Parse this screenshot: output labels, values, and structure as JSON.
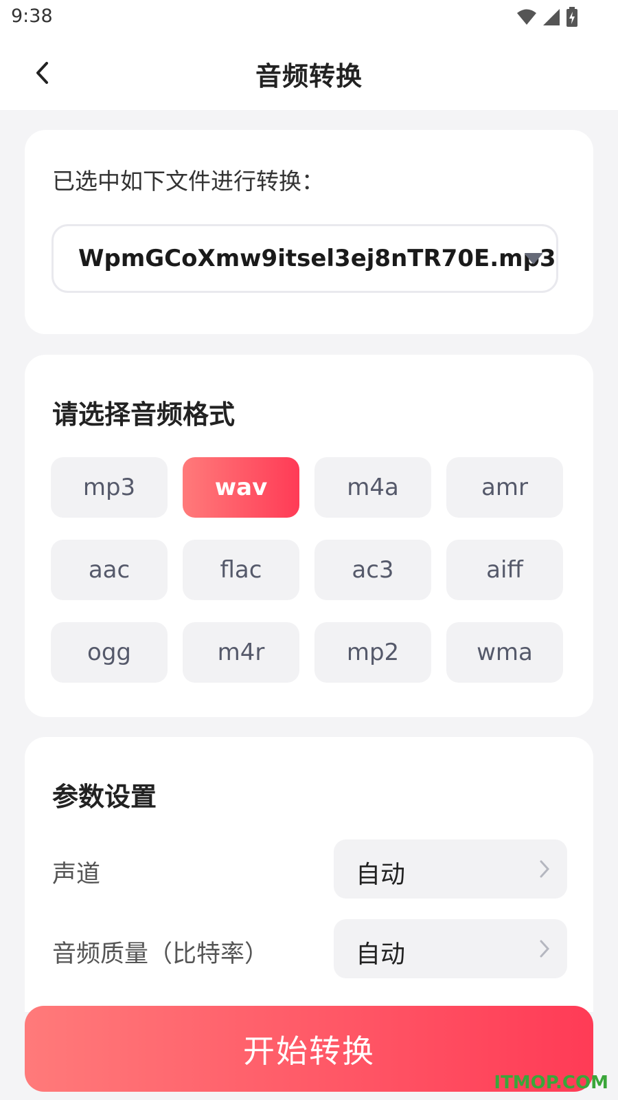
{
  "status_bar": {
    "time": "9:38",
    "icons": [
      "wifi-icon",
      "signal-icon",
      "battery-charging-icon"
    ]
  },
  "header": {
    "title": "音频转换",
    "back_icon": "chevron-left-icon"
  },
  "file_card": {
    "label": "已选中如下文件进行转换：",
    "selected_file": "WpmGCoXmw9itsel3ej8nTR70E.mp3",
    "dropdown_icon": "caret-down-icon"
  },
  "format_card": {
    "title": "请选择音频格式",
    "formats": [
      "mp3",
      "wav",
      "m4a",
      "amr",
      "aac",
      "flac",
      "ac3",
      "aiff",
      "ogg",
      "m4r",
      "mp2",
      "wma"
    ],
    "selected": "wav"
  },
  "params_card": {
    "title": "参数设置",
    "rows": [
      {
        "label": "声道",
        "value": "自动"
      },
      {
        "label": "音频质量（比特率）",
        "value": "自动"
      }
    ]
  },
  "start_button": {
    "label": "开始转换"
  },
  "watermark": "ITMOP.COM",
  "colors": {
    "accent_start": "#ff7a7a",
    "accent_end": "#ff3b56",
    "background": "#f4f4f6",
    "watermark": "#3aa63a"
  }
}
